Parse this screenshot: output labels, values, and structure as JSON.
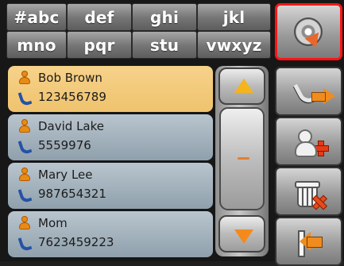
{
  "alphabet_tabs": [
    "#abc",
    "def",
    "ghi",
    "jkl",
    "mno",
    "pqr",
    "stu",
    "vwxyz"
  ],
  "contacts": [
    {
      "name": "Bob Brown",
      "phone": "123456789",
      "selected": true
    },
    {
      "name": "David Lake",
      "phone": "5559976",
      "selected": false
    },
    {
      "name": "Mary Lee",
      "phone": "987654321",
      "selected": false
    },
    {
      "name": "Mom",
      "phone": "7623459223",
      "selected": false
    }
  ],
  "icons": {
    "person": "person-icon",
    "phone": "phone-icon",
    "scroll_up": "triangle-up-icon",
    "scroll_middle": "dash-icon",
    "scroll_down": "triangle-down-icon",
    "side_buttons": [
      "disc-cursor-icon",
      "phone-arrow-icon",
      "add-user-icon",
      "trash-delete-icon",
      "back-arrow-icon"
    ]
  },
  "colors": {
    "selected_row": "#f2c86f",
    "row": "#a7b5bf",
    "accent_orange": "#f08c1e",
    "active_outline": "#ff1414"
  }
}
